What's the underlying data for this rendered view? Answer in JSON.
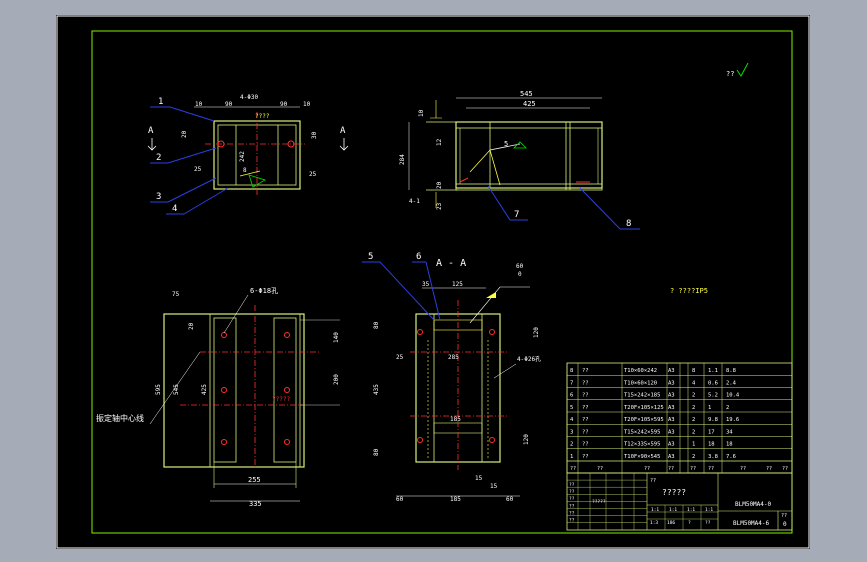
{
  "colors": {
    "background": "#a6abb8",
    "sheet": "#000000",
    "frame": "#ffffff",
    "border": "#7ff000",
    "geometry": "#d8f07a",
    "dimension": "#ffffff",
    "centerline": "#ff3030",
    "leader": "#2a3fe0",
    "weld": "#ffff40",
    "accent": "#00e000"
  },
  "roughness": {
    "mark": "??"
  },
  "top_view": {
    "balloons": [
      "1",
      "2",
      "3",
      "4"
    ],
    "section_mark": "A",
    "dims": {
      "d10a": "10",
      "d90a": "90",
      "d4phi30": "4-Φ30",
      "d90b": "90",
      "d10b": "10",
      "d20": "20",
      "d30": "30",
      "d25a": "25",
      "d242": "242",
      "d25b": "25",
      "q": "????"
    },
    "weld_symbol": "8"
  },
  "front_view": {
    "dims": {
      "d545": "545",
      "d425": "425",
      "d10": "10",
      "d12": "12",
      "d284": "284",
      "d20": "20",
      "d30": "30",
      "d23": "23",
      "weld5": "5"
    },
    "weld_label": "4-1",
    "balloons": [
      "5",
      "7",
      "8"
    ]
  },
  "plan_view": {
    "holes_label": "6-Φ18孔",
    "dims": {
      "d75": "75",
      "d595": "595",
      "d545": "545",
      "d425": "425",
      "d20": "20",
      "d140": "140",
      "d200": "200",
      "d255": "255",
      "d335": "335"
    },
    "axis_label": "振定轴中心线",
    "centerline_note": "?????"
  },
  "section_view": {
    "title": "A - A",
    "balloons": [
      "5",
      "6"
    ],
    "dims": {
      "d35": "35",
      "d125": "125",
      "d80a": "80",
      "d285": "285",
      "d25": "25",
      "d435": "435",
      "d185": "185",
      "d80b": "80",
      "d15a": "15",
      "d60a": "60",
      "d185b": "185",
      "d15b": "15",
      "d60b": "60",
      "d120a": "120",
      "d120b": "120",
      "holes": "4-Φ26孔"
    },
    "weld_symbol": {
      "size": "60",
      "num": "0"
    }
  },
  "tech_note": "?    ????IP5",
  "bom": {
    "rows": [
      {
        "no": "8",
        "name": "??",
        "spec": "T10×60×242",
        "mat": "A3",
        "qty": "8",
        "w1": "1.1",
        "w2": "8.8"
      },
      {
        "no": "7",
        "name": "??",
        "spec": "T10×60×120",
        "mat": "A3",
        "qty": "4",
        "w1": "0.6",
        "w2": "2.4"
      },
      {
        "no": "6",
        "name": "??",
        "spec": "T15×242×185",
        "mat": "A3",
        "qty": "2",
        "w1": "5.2",
        "w2": "10.4"
      },
      {
        "no": "5",
        "name": "??",
        "spec": "T20F×105×125",
        "mat": "A3",
        "qty": "2",
        "w1": "1",
        "w2": "2"
      },
      {
        "no": "4",
        "name": "??",
        "spec": "T20F×105×595",
        "mat": "A3",
        "qty": "2",
        "w1": "9.8",
        "w2": "19.6"
      },
      {
        "no": "3",
        "name": "??",
        "spec": "T15×242×595",
        "mat": "A3",
        "qty": "2",
        "w1": "17",
        "w2": "34"
      },
      {
        "no": "2",
        "name": "??",
        "spec": "T12×335×595",
        "mat": "A3",
        "qty": "1",
        "w1": "18",
        "w2": "18"
      },
      {
        "no": "1",
        "name": "??",
        "spec": "T10F×90×545",
        "mat": "A3",
        "qty": "2",
        "w1": "3.8",
        "w2": "7.6"
      }
    ],
    "header": [
      "??",
      "??",
      "??",
      "??",
      "??",
      "??",
      "??",
      "??",
      "??"
    ]
  },
  "title_block": {
    "title": "?????",
    "code_top": "BLM50MA4-0",
    "code_bottom": "BLM50MA4-6",
    "small_a": "??",
    "small_b": "?????",
    "qty_labels": [
      "1:1",
      "1:1",
      "1:1",
      "1:1"
    ],
    "sheet_info": [
      "1:3",
      "186",
      "?",
      "??"
    ],
    "right_small": [
      "??",
      "0"
    ],
    "left_labels": [
      "??",
      "??",
      "??",
      "??",
      "??",
      "??"
    ]
  }
}
